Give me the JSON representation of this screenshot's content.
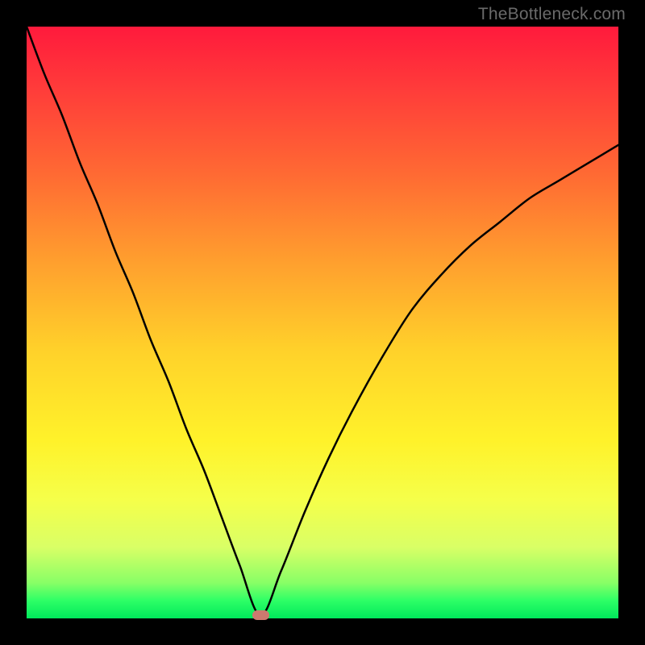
{
  "watermark": "TheBottleneck.com",
  "colors": {
    "frame": "#000000",
    "watermark": "#6a6a6a",
    "curve": "#000000",
    "marker": "#cd7a6f",
    "gradient_stops": [
      "#ff1a3c",
      "#ff3a3a",
      "#ff6a33",
      "#ffa02e",
      "#ffd22a",
      "#fff22a",
      "#f5ff4a",
      "#d9ff66",
      "#88ff66",
      "#2dff66",
      "#00e85b"
    ]
  },
  "chart_data": {
    "type": "line",
    "title": "",
    "xlabel": "",
    "ylabel": "",
    "xlim": [
      0,
      100
    ],
    "ylim": [
      0,
      100
    ],
    "grid": false,
    "description": "Bottleneck curve plotted over a red-to-green vertical gradient. The curve descends steeply from the upper-left, reaches a minimum near x≈40 at y≈0, then rises again toward the right asymptotically approaching y≈80. A small rounded marker sits at the minimum.",
    "series": [
      {
        "name": "bottleneck-curve",
        "x": [
          0,
          3,
          6,
          9,
          12,
          15,
          18,
          21,
          24,
          27,
          30,
          33,
          36,
          39.5,
          43,
          47,
          51,
          55,
          60,
          65,
          70,
          75,
          80,
          85,
          90,
          95,
          100
        ],
        "y": [
          100,
          92,
          85,
          77,
          70,
          62,
          55,
          47,
          40,
          32,
          25,
          17,
          9,
          0.5,
          8,
          18,
          27,
          35,
          44,
          52,
          58,
          63,
          67,
          71,
          74,
          77,
          80
        ]
      }
    ],
    "minimum_marker": {
      "x": 39.5,
      "y": 0.5
    }
  }
}
